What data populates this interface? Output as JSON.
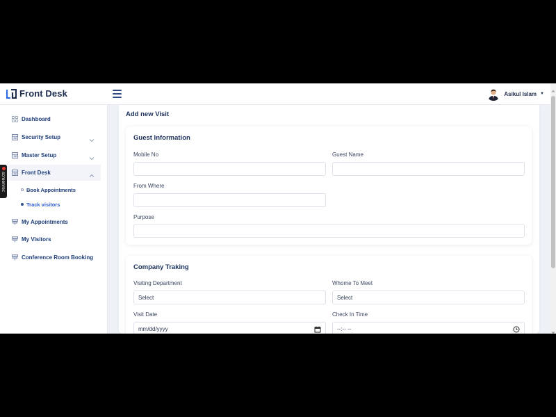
{
  "app": {
    "brand": "Front Desk"
  },
  "user": {
    "name": "Asikul Islam"
  },
  "sidebar": {
    "items": [
      {
        "label": "Dashboard",
        "icon": "grid-icon"
      },
      {
        "label": "Security Setup",
        "icon": "list-icon"
      },
      {
        "label": "Master Setup",
        "icon": "list-icon"
      },
      {
        "label": "Front Desk",
        "icon": "list-icon"
      },
      {
        "label": "My Appointments",
        "icon": "stack-icon"
      },
      {
        "label": "My Visitors",
        "icon": "stack-icon"
      },
      {
        "label": "Conference Room Booking",
        "icon": "stack-icon"
      }
    ],
    "sub_items": [
      {
        "label": "Book Appointments"
      },
      {
        "label": "Track visitors"
      }
    ]
  },
  "overlay": {
    "screenrec_label": "screenrec"
  },
  "page": {
    "title": "Add new Visit"
  },
  "guest_card": {
    "title": "Guest Information",
    "mobile_label": "Mobile No",
    "mobile_value": "",
    "guest_name_label": "Guest Name",
    "guest_name_value": "",
    "from_where_label": "From Where",
    "from_where_value": "",
    "purpose_label": "Purpose",
    "purpose_value": ""
  },
  "company_card": {
    "title": "Company Traking",
    "department_label": "Visiting Department",
    "department_value": "Select",
    "whome_label": "Whome To Meet",
    "whome_value": "Select",
    "visit_date_label": "Visit Date",
    "visit_date_value": "mm/dd/yyyy",
    "check_in_label": "Check In Time",
    "check_in_value": "--:-- --"
  },
  "colors": {
    "brand": "#1b2c4d",
    "accent": "#2d4a86",
    "nav_text": "#1f3e7a",
    "background": "#eef2f7"
  }
}
